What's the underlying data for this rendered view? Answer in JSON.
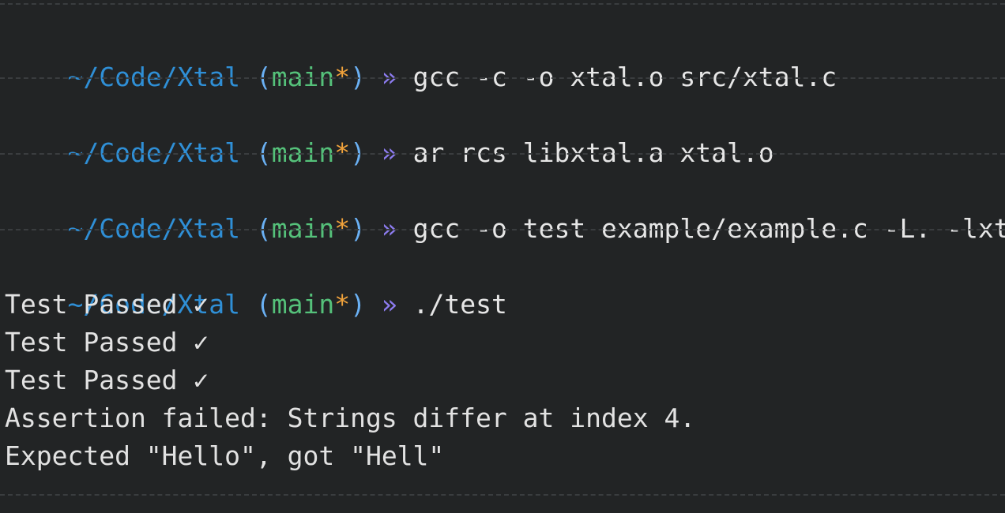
{
  "prompt": {
    "path": "~/Code/Xtal",
    "open_paren": "(",
    "branch": "main",
    "dirty_marker": "*",
    "close_paren": ")",
    "arrow": "»"
  },
  "commands": [
    "gcc -c -o xtal.o src/xtal.c",
    "ar rcs libxtal.a xtal.o",
    "gcc -o test example/example.c -L. -lxtal",
    "./test"
  ],
  "output": [
    "Test Passed ✓",
    "Test Passed ✓",
    "Test Passed ✓",
    "Assertion failed: Strings differ at index 4.",
    "Expected \"Hello\", got \"Hell\""
  ],
  "colors": {
    "background": "#222425",
    "path": "#2f8fd6",
    "branch": "#55c17a",
    "dirty": "#f0a23b",
    "arrow": "#8d7cf0"
  }
}
